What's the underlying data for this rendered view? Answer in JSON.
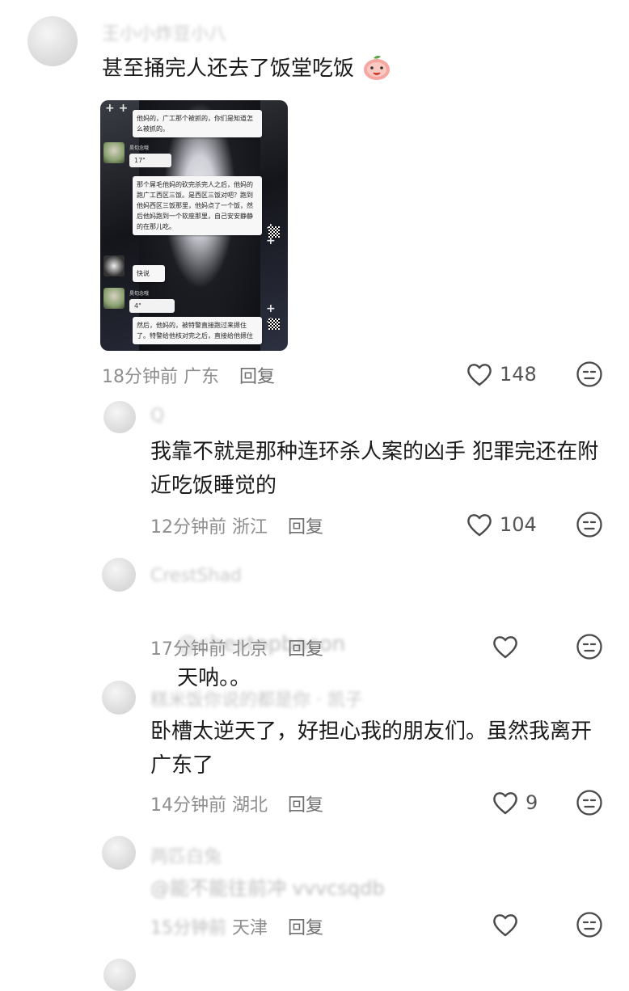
{
  "comments": [
    {
      "author": "王小小炸豆小八",
      "text": "甚至捅完人还去了饭堂吃饭",
      "time": "18分钟前",
      "location": "广东",
      "reply_label": "回复",
      "likes": "148",
      "image": {
        "bubble1": "他妈的，广工那个被抓的，你们是知道怎么被抓的。",
        "voice1": "17\"",
        "name1": "昊旬念哦",
        "bubble2": "那个屌毛他妈的砍完杀完人之后，他妈的跑广工西区三饭。是西区三饭对吧？跑到他妈西区三饭那里，他妈点了一个饭，然后他妈跑到一个软座那里，自己安安静静的在那儿吃。",
        "bubble3": "快说",
        "name2": "昊旬念哦",
        "voice2": "4\"",
        "bubble4": "然后，他妈的，被特警直接跑过来摁住了。特警给他核对完之后，直接给他摁住"
      }
    },
    {
      "author": "Q",
      "text": "我靠不就是那种连环杀人案的凶手 犯罪完还在附近吃饭睡觉的",
      "time": "12分钟前",
      "location": "浙江",
      "reply_label": "回复",
      "likes": "104"
    },
    {
      "author": "CrestShad",
      "prefix": "@chestopbacon",
      "text": "天呐。。",
      "time": "17分钟前",
      "location": "北京",
      "reply_label": "回复",
      "likes": ""
    },
    {
      "author": "糕米饭你说的都是你 · 凯子",
      "text": "卧槽太逆天了，好担心我的朋友们。虽然我离开广东了",
      "time": "14分钟前",
      "location": "湖北",
      "reply_label": "回复",
      "likes": "9"
    },
    {
      "author": "两匹白兔",
      "text": "@能不能往前冲 vvvcsqdb",
      "time": "15分钟前",
      "location": "天津",
      "reply_label": "回复",
      "likes": ""
    }
  ],
  "icons": {
    "like": "heart-outline-icon",
    "dislike": "meh-face-icon"
  }
}
